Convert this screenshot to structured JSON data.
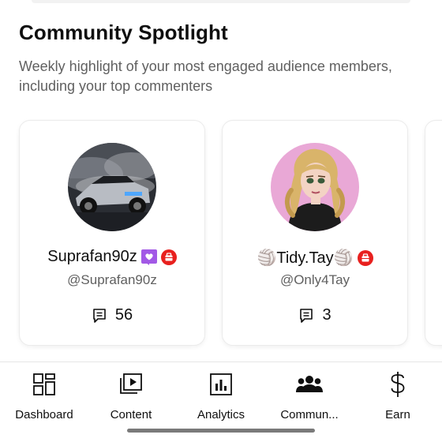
{
  "header": {
    "title": "Community Spotlight",
    "subtitle": "Weekly highlight of your most engaged audience members, including your top commenters"
  },
  "members": [
    {
      "display_name": "Suprafan90z",
      "handle": "@Suprafan90z",
      "comment_count": "56",
      "badges": [
        "heart-badge-icon",
        "member-badge-icon"
      ]
    },
    {
      "display_name": "🏐Tidy.Tay🏐",
      "handle": "@Only4Tay",
      "comment_count": "3",
      "badges": [
        "member-badge-icon"
      ]
    }
  ],
  "nav": {
    "items": [
      {
        "label": "Dashboard",
        "icon": "dashboard-icon"
      },
      {
        "label": "Content",
        "icon": "content-icon"
      },
      {
        "label": "Analytics",
        "icon": "analytics-icon"
      },
      {
        "label": "Commun...",
        "icon": "community-icon"
      },
      {
        "label": "Earn",
        "icon": "earn-icon"
      }
    ]
  },
  "colors": {
    "text": "#0f0f0f",
    "secondary_text": "#606060",
    "badge_purple": "#a259e6",
    "badge_red": "#e8201e"
  }
}
